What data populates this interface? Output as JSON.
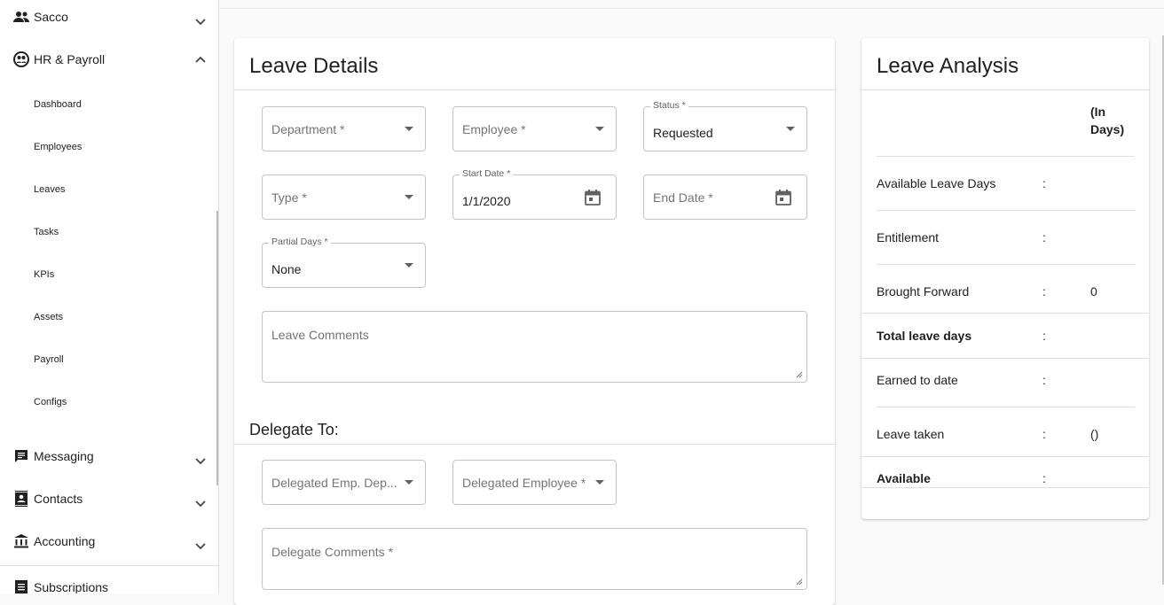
{
  "sidebar": {
    "top_items": [
      {
        "label": "Sacco",
        "icon": "people-icon",
        "expanded": false
      },
      {
        "label": "HR & Payroll",
        "icon": "hr-icon",
        "expanded": true
      }
    ],
    "hr_sub_items": [
      {
        "label": "Dashboard"
      },
      {
        "label": "Employees"
      },
      {
        "label": "Leaves"
      },
      {
        "label": "Tasks"
      },
      {
        "label": "KPIs"
      },
      {
        "label": "Assets"
      },
      {
        "label": "Payroll"
      },
      {
        "label": "Configs"
      }
    ],
    "bottom_items": [
      {
        "label": "Messaging",
        "icon": "message-icon"
      },
      {
        "label": "Contacts",
        "icon": "contacts-icon"
      },
      {
        "label": "Accounting",
        "icon": "bank-icon"
      }
    ],
    "footer_item": {
      "label": "Subscriptions",
      "icon": "list-icon"
    }
  },
  "leave_details": {
    "title": "Leave Details",
    "department": {
      "placeholder": "Department *"
    },
    "employee": {
      "placeholder": "Employee *"
    },
    "status": {
      "label": "Status *",
      "value": "Requested"
    },
    "type": {
      "placeholder": "Type *"
    },
    "start_date": {
      "label": "Start Date *",
      "value": "1/1/2020"
    },
    "end_date": {
      "placeholder": "End Date *"
    },
    "partial_days": {
      "label": "Partial Days *",
      "value": "None"
    },
    "leave_comments": {
      "placeholder": "Leave Comments"
    },
    "delegate_title": "Delegate To:",
    "delegated_dept": {
      "placeholder": "Delegated Emp. Dep..."
    },
    "delegated_employee": {
      "placeholder": "Delegated Employee *"
    },
    "delegate_comments": {
      "placeholder": "Delegate Comments *"
    }
  },
  "leave_analysis": {
    "title": "Leave Analysis",
    "unit_header": "(In Days)",
    "rows": [
      {
        "label": "Available Leave Days",
        "colon": ":",
        "value": "",
        "bold": false
      },
      {
        "label": "Entitlement",
        "colon": ":",
        "value": "",
        "bold": false
      },
      {
        "label": "Brought Forward",
        "colon": ":",
        "value": "0",
        "bold": false
      },
      {
        "label": "Total leave days",
        "colon": ":",
        "value": "",
        "bold": true
      },
      {
        "label": "Earned to date",
        "colon": ":",
        "value": "",
        "bold": false
      },
      {
        "label": "Leave taken",
        "colon": ":",
        "value": "()",
        "bold": false
      },
      {
        "label": "Available",
        "colon": ":",
        "value": "",
        "bold": true
      }
    ]
  }
}
